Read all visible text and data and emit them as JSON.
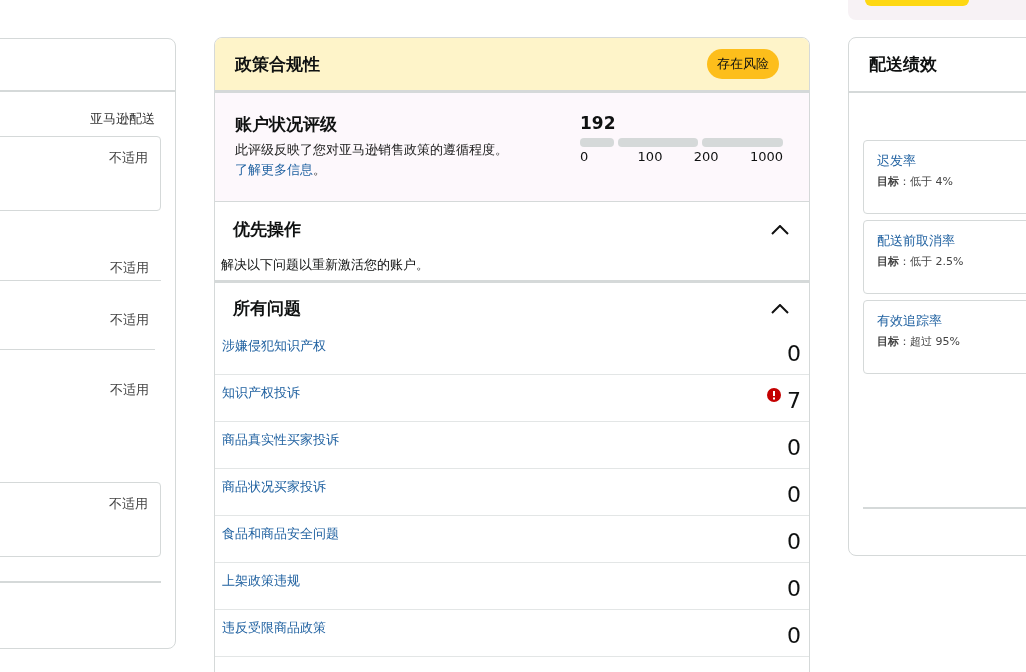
{
  "left_card": {
    "column_label": "亚马逊配送",
    "rows": [
      {
        "kind": "boxed",
        "value": "不适用"
      },
      {
        "kind": "plain",
        "value": "不适用"
      },
      {
        "kind": "plain",
        "value": "不适用"
      },
      {
        "kind": "tall",
        "value": "不适用"
      },
      {
        "kind": "boxed",
        "value": "不适用"
      }
    ]
  },
  "policy": {
    "title": "政策合规性",
    "status": "存在风险",
    "health": {
      "title": "账户状况评级",
      "description": "此评级反映了您对亚马逊销售政策的遵循程度。",
      "link": "了解更多信息",
      "after_link": "。",
      "score": "192",
      "ticks": [
        "0",
        "100",
        "200",
        "1000"
      ]
    },
    "priority": {
      "title": "优先操作",
      "expanded": true,
      "note": "解决以下问题以重新激活您的账户。"
    },
    "all_issues": {
      "title": "所有问题",
      "expanded": true,
      "issues": [
        {
          "label": "涉嫌侵犯知识产权",
          "count": "0",
          "alert": false
        },
        {
          "label": "知识产权投诉",
          "count": "7",
          "alert": true
        },
        {
          "label": "商品真实性买家投诉",
          "count": "0",
          "alert": false
        },
        {
          "label": "商品状况买家投诉",
          "count": "0",
          "alert": false
        },
        {
          "label": "食品和商品安全问题",
          "count": "0",
          "alert": false
        },
        {
          "label": "上架政策违规",
          "count": "0",
          "alert": false
        },
        {
          "label": "违反受限商品政策",
          "count": "0",
          "alert": false
        }
      ]
    }
  },
  "shipping": {
    "title": "配送绩效",
    "metrics": [
      {
        "name": "迟发率",
        "target_label": "目标",
        "target": "：低于 4%"
      },
      {
        "name": "配送前取消率",
        "target_label": "目标",
        "target": "：低于 2.5%"
      },
      {
        "name": "有效追踪率",
        "target_label": "目标",
        "target": "：超过 95%"
      }
    ]
  }
}
